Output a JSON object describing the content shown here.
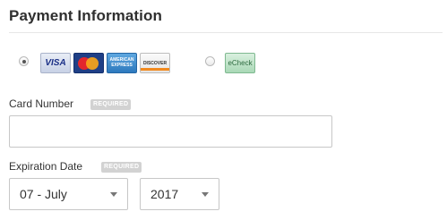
{
  "section": {
    "title": "Payment Information"
  },
  "payment_methods": {
    "credit_card": {
      "selected": true,
      "logos": {
        "visa": "VISA",
        "mastercard": "",
        "amex": "AMERICAN\nEXPRESS",
        "discover": "DISCOVER"
      }
    },
    "echeck": {
      "selected": false,
      "label": "eCheck"
    }
  },
  "card_number": {
    "label": "Card Number",
    "required_badge": "REQUIRED",
    "value": "",
    "placeholder": ""
  },
  "expiration": {
    "label": "Expiration Date",
    "required_badge": "REQUIRED",
    "month": "07 - July",
    "year": "2017"
  },
  "colors": {
    "rule": "#e6e6e6",
    "badge": "#d2d2d2",
    "input_border": "#c7c7c7"
  }
}
